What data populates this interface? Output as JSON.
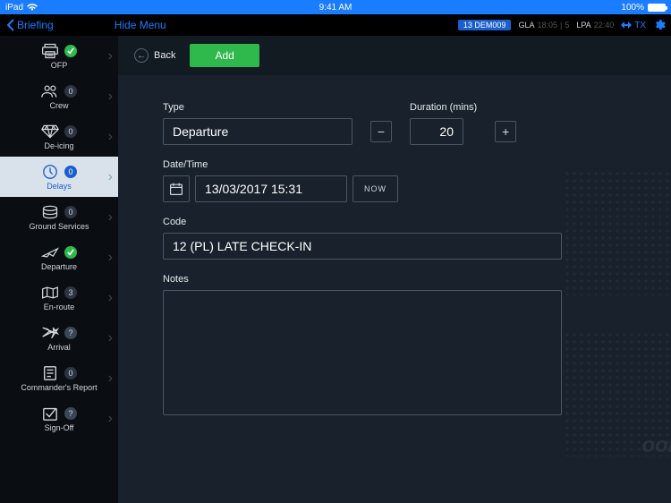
{
  "status": {
    "carrier": "iPad",
    "time": "9:41 AM",
    "battery": "100%"
  },
  "header": {
    "back": "Briefing",
    "hide_menu": "Hide Menu",
    "flight_pill": "13 DEM009",
    "orig": "GLA",
    "orig_t": "18:05",
    "orig_s": "5",
    "dest": "LPA",
    "dest_t": "22:40",
    "tx": "TX"
  },
  "sidebar": {
    "items": [
      {
        "label": "OFP",
        "badge_type": "chk"
      },
      {
        "label": "Crew",
        "badge_type": "num",
        "badge": "0"
      },
      {
        "label": "De-icing",
        "badge_type": "num",
        "badge": "0"
      },
      {
        "label": "Delays",
        "badge_type": "num",
        "badge": "0",
        "active": true
      },
      {
        "label": "Ground Services",
        "badge_type": "num",
        "badge": "0"
      },
      {
        "label": "Departure",
        "badge_type": "chk"
      },
      {
        "label": "En-route",
        "badge_type": "num",
        "badge": "3"
      },
      {
        "label": "Arrival",
        "badge_type": "q",
        "badge": "?"
      },
      {
        "label": "Commander's Report",
        "badge_type": "num",
        "badge": "0"
      },
      {
        "label": "Sign-Off",
        "badge_type": "q",
        "badge": "?"
      }
    ]
  },
  "strip": {
    "back": "Back",
    "add": "Add"
  },
  "form": {
    "type_label": "Type",
    "type_value": "Departure",
    "duration_label": "Duration (mins)",
    "duration_value": "20",
    "minus": "−",
    "plus": "+",
    "datetime_label": "Date/Time",
    "datetime_value": "13/03/2017 15:31",
    "now": "NOW",
    "code_label": "Code",
    "code_value": "12 (PL) LATE CHECK-IN",
    "notes_label": "Notes",
    "notes_value": ""
  },
  "watermark": "ook"
}
